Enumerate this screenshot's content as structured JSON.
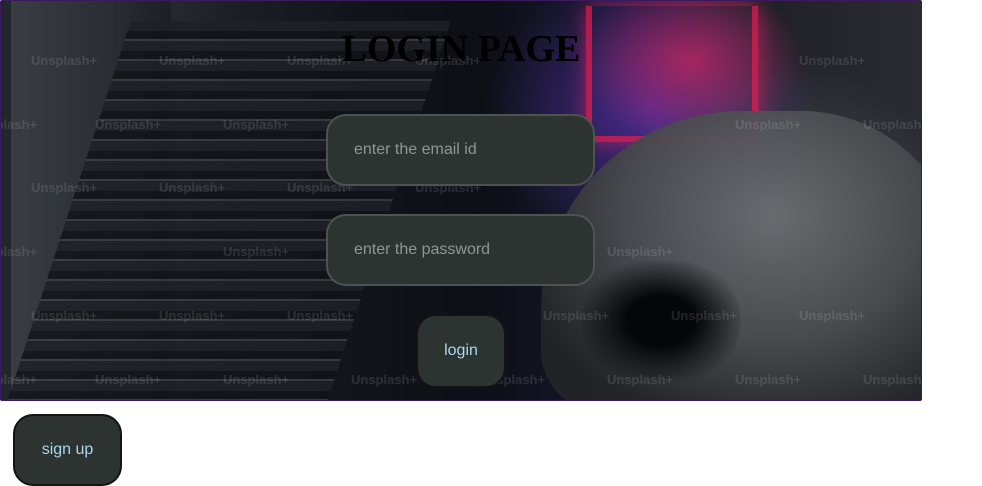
{
  "page": {
    "title": "LOGIN PAGE"
  },
  "background": {
    "watermark_text": "Unsplash+"
  },
  "form": {
    "email_placeholder": "enter the email id",
    "password_placeholder": "enter the password",
    "login_label": "login"
  },
  "signup": {
    "label": "sign up"
  },
  "colors": {
    "field_bg": "#2c3330",
    "button_text": "#a9d8ee"
  }
}
